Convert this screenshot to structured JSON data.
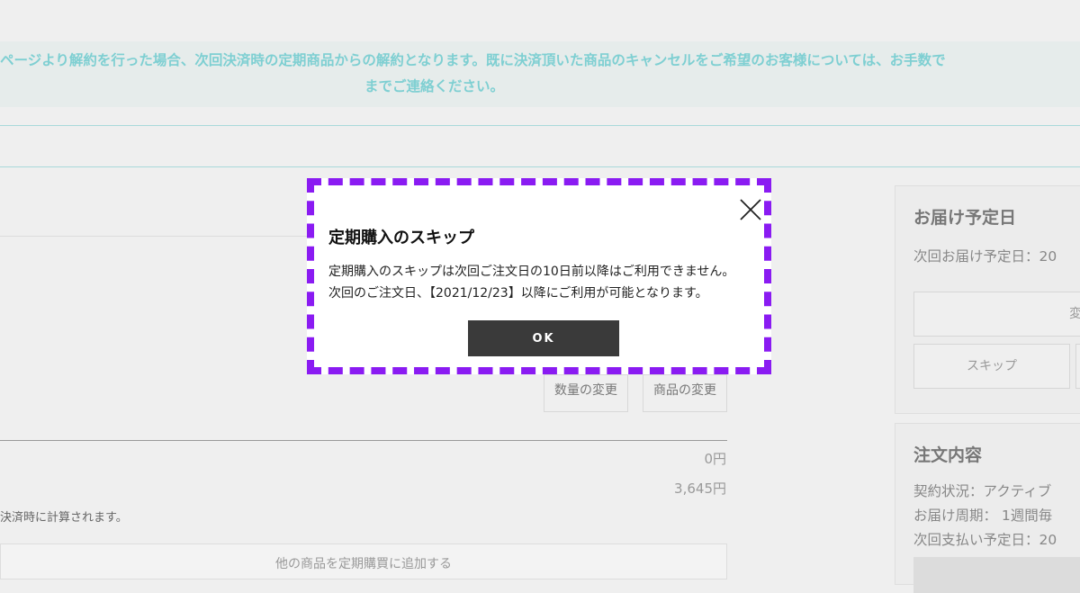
{
  "notice": {
    "line1": "ページより解約を行った場合、次回決済時の定期商品からの解約となります。既に決済頂いた商品のキャンセルをご希望のお客様については、お手数で",
    "line2": "までご連絡ください。"
  },
  "item_actions": {
    "quantity_change": "数量の変更",
    "product_change": "商品の変更"
  },
  "prices": {
    "shipping": "0円",
    "total": "3,645円"
  },
  "note": "決済時に計算されます。",
  "add_product": "他の商品を定期購買に追加する",
  "delivery_panel": {
    "title": "お届け予定日",
    "next_delivery": "次回お届け予定日：20",
    "change_button": "変更",
    "skip_button": "スキップ"
  },
  "order_panel": {
    "title": "注文内容",
    "status": "契約状況：アクティブ",
    "cycle": "お届け周期：  1週間毎",
    "next_payment": "次回支払い予定日：20"
  },
  "modal": {
    "title": "定期購入のスキップ",
    "body_line1": "定期購入のスキップは次回ご注文日の10日前以降はご利用できません。",
    "body_line2": "次回のご注文日、【2021/12/23】以降にご利用が可能となります。",
    "ok_label": "OK",
    "accent_color": "#8a1bf2"
  }
}
